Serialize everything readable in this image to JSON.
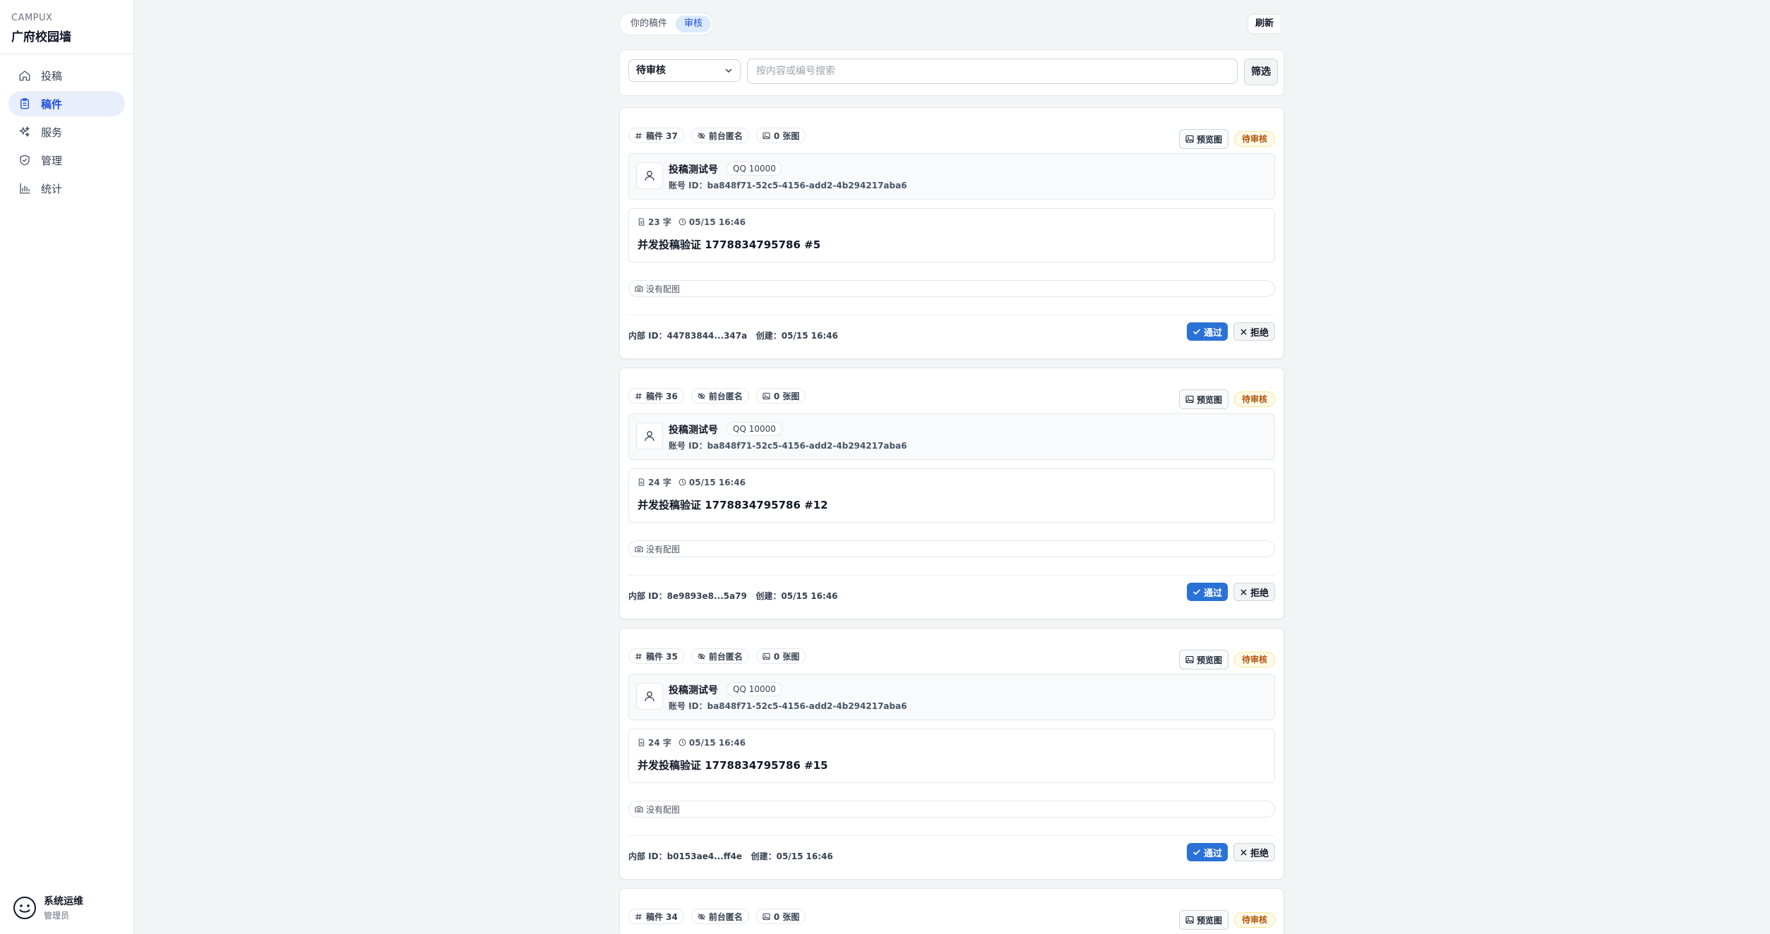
{
  "brand": {
    "kicker": "CAMPUX",
    "title": "广府校园墙"
  },
  "nav": {
    "items": [
      {
        "label": "投稿",
        "icon": "home-icon"
      },
      {
        "label": "稿件",
        "icon": "clipboard-icon"
      },
      {
        "label": "服务",
        "icon": "sparkles-icon"
      },
      {
        "label": "管理",
        "icon": "shield-check-icon"
      },
      {
        "label": "统计",
        "icon": "bar-chart-icon"
      }
    ],
    "active_index": 1
  },
  "user": {
    "name": "系统运维",
    "role": "管理员"
  },
  "topbar": {
    "tab_mine": "你的稿件",
    "tab_review": "审核",
    "refresh": "刷新"
  },
  "filter": {
    "status": "待审核",
    "search_placeholder": "按内容或编号搜索",
    "filter_btn": "筛选"
  },
  "labels": {
    "anonymous": "前台匿名",
    "preview": "预览图",
    "account_prefix": "账号 ID：",
    "no_image": "没有配图",
    "internal_prefix": "内部 ID：",
    "created_prefix": "创建：",
    "approve": "通过",
    "reject": "拒绝"
  },
  "posts": [
    {
      "number": "稿件 37",
      "images": "0 张图",
      "status": "待审核",
      "author_name": "投稿测试号",
      "qq": "QQ 10000",
      "account_id": "ba848f71-52c5-4156-add2-4b294217aba6",
      "chars": "23 字",
      "time": "05/15 16:46",
      "content": "并发投稿验证 1778834795786 #5",
      "internal_id": "44783844...347a",
      "created": "05/15 16:46"
    },
    {
      "number": "稿件 36",
      "images": "0 张图",
      "status": "待审核",
      "author_name": "投稿测试号",
      "qq": "QQ 10000",
      "account_id": "ba848f71-52c5-4156-add2-4b294217aba6",
      "chars": "24 字",
      "time": "05/15 16:46",
      "content": "并发投稿验证 1778834795786 #12",
      "internal_id": "8e9893e8...5a79",
      "created": "05/15 16:46"
    },
    {
      "number": "稿件 35",
      "images": "0 张图",
      "status": "待审核",
      "author_name": "投稿测试号",
      "qq": "QQ 10000",
      "account_id": "ba848f71-52c5-4156-add2-4b294217aba6",
      "chars": "24 字",
      "time": "05/15 16:46",
      "content": "并发投稿验证 1778834795786 #15",
      "internal_id": "b0153ae4...ff4e",
      "created": "05/15 16:46"
    },
    {
      "number": "稿件 34",
      "images": "0 张图",
      "status": "待审核"
    }
  ]
}
